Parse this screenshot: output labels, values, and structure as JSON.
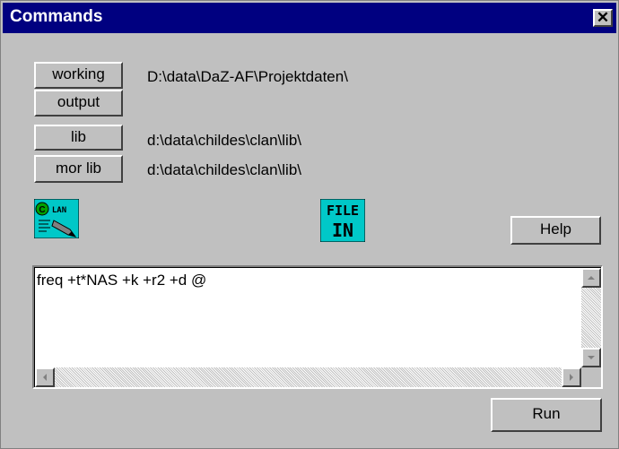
{
  "window": {
    "title": "Commands"
  },
  "directories": [
    {
      "label": "working",
      "path": "D:\\data\\DaZ-AF\\Projektdaten\\"
    },
    {
      "label": "output",
      "path": ""
    },
    {
      "label": "lib",
      "path": "d:\\data\\childes\\clan\\lib\\"
    },
    {
      "label": "mor lib",
      "path": "d:\\data\\childes\\clan\\lib\\"
    }
  ],
  "icons": {
    "clan_label": "CLAN",
    "file_in_line1": "FILE",
    "file_in_line2": "IN"
  },
  "help_label": "Help",
  "command_text": "freq +t*NAS +k +r2 +d @",
  "run_label": "Run"
}
